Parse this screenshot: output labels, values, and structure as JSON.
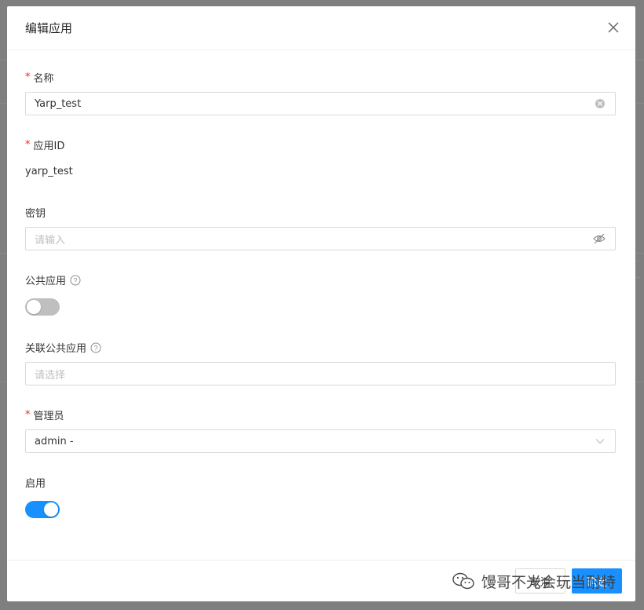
{
  "modal": {
    "title": "编辑应用"
  },
  "form": {
    "name": {
      "label": "名称",
      "required": true,
      "value": "Yarp_test"
    },
    "app_id": {
      "label": "应用ID",
      "required": true,
      "value": "yarp_test"
    },
    "secret": {
      "label": "密钥",
      "required": false,
      "placeholder": "请输入"
    },
    "public_app": {
      "label": "公共应用",
      "enabled": false
    },
    "linked_public_app": {
      "label": "关联公共应用",
      "placeholder": "请选择"
    },
    "admin": {
      "label": "管理员",
      "required": true,
      "value": "admin -"
    },
    "enable": {
      "label": "启用",
      "enabled": true
    }
  },
  "footer": {
    "cancel_label": "取消",
    "ok_label": "确定"
  },
  "watermark": {
    "text": "馒哥不光会玩当耐特"
  },
  "colors": {
    "primary": "#1890ff",
    "required": "#f5222d",
    "mask": "#7f7f7f",
    "switch_off": "#bfbfbf"
  },
  "icons": {
    "close": "close-icon",
    "clear": "clear-circle-icon",
    "eye": "eye-invisible-icon",
    "help": "question-circle-icon",
    "chevron": "chevron-down-icon",
    "watermark": "wechat-icon"
  }
}
